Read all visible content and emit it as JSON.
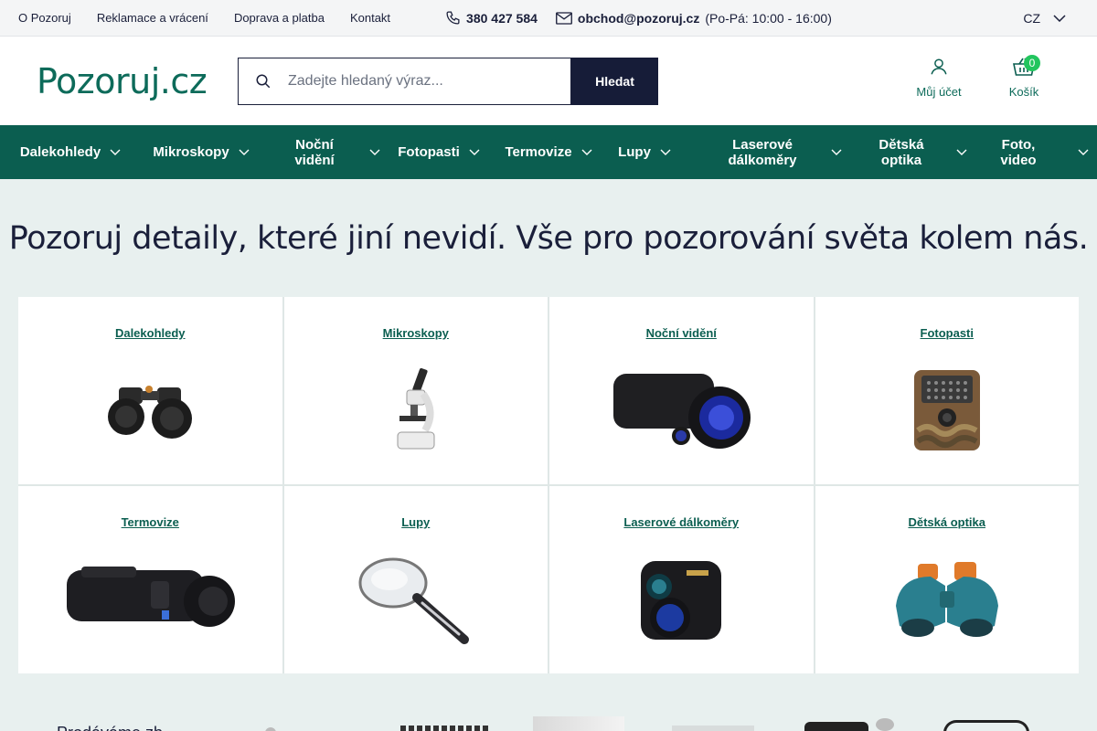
{
  "topbar": {
    "links": [
      "O Pozoruj",
      "Reklamace a vrácení",
      "Doprava a platba",
      "Kontakt"
    ],
    "phone": "380 427 584",
    "email": "obchod@pozoruj.cz",
    "hours": "(Po-Pá: 10:00 - 16:00)",
    "language": "CZ"
  },
  "header": {
    "logo": "Pozoruj.cz",
    "search_placeholder": "Zadejte hledaný výraz...",
    "search_button": "Hledat",
    "account_label": "Můj účet",
    "cart_label": "Košík",
    "cart_count": "0"
  },
  "nav": {
    "items": [
      {
        "label": "Dalekohledy"
      },
      {
        "label": "Mikroskopy"
      },
      {
        "label": "Noční vidění"
      },
      {
        "label": "Fotopasti"
      },
      {
        "label": "Termovize"
      },
      {
        "label": "Lupy"
      },
      {
        "label": "Laserové dálkoměry"
      },
      {
        "label": "Dětská optika"
      },
      {
        "label": "Foto, video"
      }
    ]
  },
  "hero": {
    "headline": "Pozoruj detaily, které jiní nevidí. Vše pro pozorování světa kolem nás."
  },
  "categories": [
    {
      "title": "Dalekohledy"
    },
    {
      "title": "Mikroskopy"
    },
    {
      "title": "Noční vidění"
    },
    {
      "title": "Fotopasti"
    },
    {
      "title": "Termovize"
    },
    {
      "title": "Lupy"
    },
    {
      "title": "Laserové dálkoměry"
    },
    {
      "title": "Dětská optika"
    }
  ],
  "brands": {
    "heading": "Prodáváme zb"
  },
  "colors": {
    "primary": "#0b5e50",
    "dark": "#161c38",
    "badge": "#22c55e",
    "background": "#e8f0ef"
  }
}
